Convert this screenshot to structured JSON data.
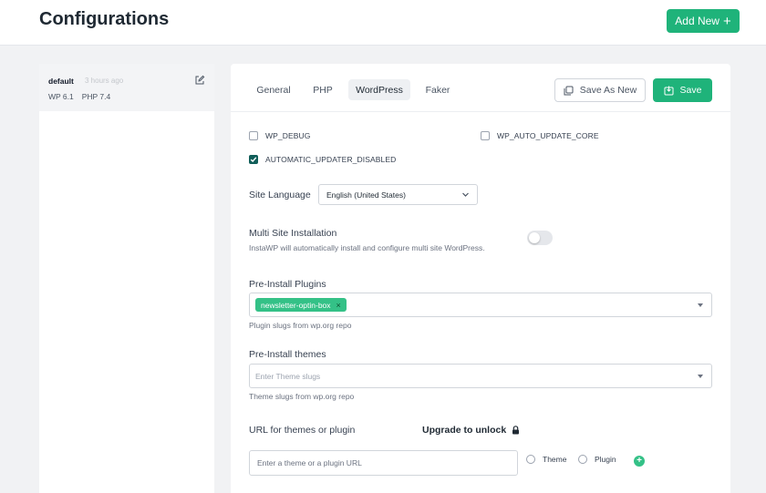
{
  "header": {
    "title": "Configurations",
    "add_new_label": "Add New",
    "accent_color": "#1fb37a"
  },
  "sidebar": {
    "items": [
      {
        "name": "default",
        "time": "3 hours ago",
        "wp_version": "WP 6.1",
        "php_version": "PHP 7.4",
        "icon": "edit-icon"
      }
    ]
  },
  "tabs": [
    {
      "label": "General",
      "active": false
    },
    {
      "label": "PHP",
      "active": false
    },
    {
      "label": "WordPress",
      "active": true
    },
    {
      "label": "Faker",
      "active": false
    }
  ],
  "actions": {
    "save_as_new_label": "Save As New",
    "save_label": "Save"
  },
  "options": {
    "wp_debug": {
      "label": "WP_DEBUG",
      "checked": false
    },
    "wp_auto_update_core": {
      "label": "WP_AUTO_UPDATE_CORE",
      "checked": false
    },
    "automatic_updater_disabled": {
      "label": "AUTOMATIC_UPDATER_DISABLED",
      "checked": true
    }
  },
  "site_language": {
    "label": "Site Language",
    "value": "English (United States)"
  },
  "multisite": {
    "label": "Multi Site Installation",
    "hint": "InstaWP will automatically install and configure multi site WordPress.",
    "enabled": false
  },
  "plugins": {
    "label": "Pre-Install Plugins",
    "chips": [
      "newsletter-optin-box"
    ],
    "hint": "Plugin slugs from wp.org repo"
  },
  "themes": {
    "label": "Pre-Install themes",
    "placeholder": "Enter Theme slugs",
    "hint": "Theme slugs from wp.org repo"
  },
  "url_install": {
    "label": "URL for themes or plugin",
    "upgrade_label": "Upgrade to unlock",
    "placeholder": "Enter a theme or a plugin URL",
    "radio_theme": "Theme",
    "radio_plugin": "Plugin"
  }
}
